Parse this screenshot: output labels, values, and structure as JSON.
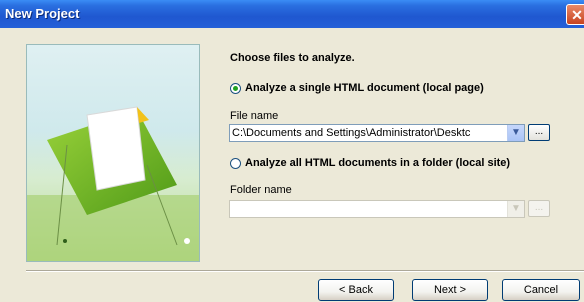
{
  "window": {
    "title": "New Project",
    "close_glyph": "✕"
  },
  "content": {
    "heading": "Choose files to analyze.",
    "option_single": {
      "label": "Analyze a single HTML document (local page)",
      "selected": true
    },
    "file_name": {
      "label": "File name",
      "value": "C:\\Documents and Settings\\Administrator\\Desktc",
      "browse_label": "..."
    },
    "option_folder": {
      "label": "Analyze all HTML documents in a folder (local site)",
      "selected": false
    },
    "folder_name": {
      "label": "Folder name",
      "value": "",
      "browse_label": "..."
    }
  },
  "buttons": {
    "back": "< Back",
    "next": "Next >",
    "cancel": "Cancel"
  },
  "icons": {
    "dropdown": "chevron-down-icon",
    "close": "close-icon"
  }
}
